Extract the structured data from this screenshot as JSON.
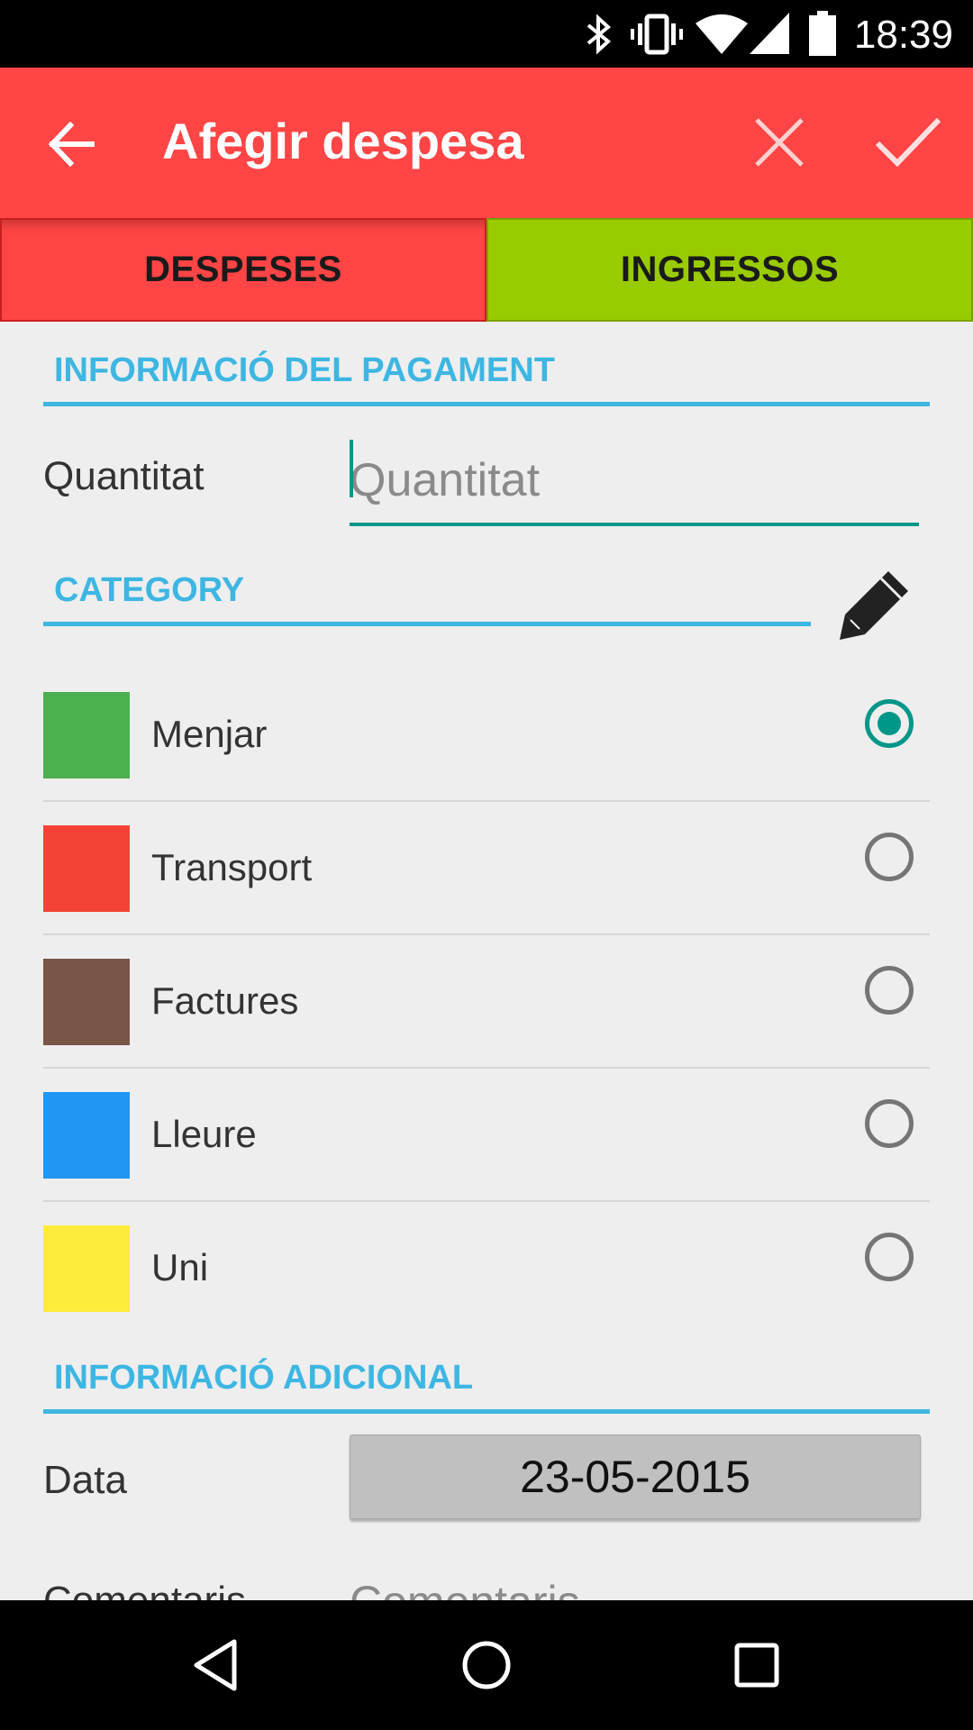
{
  "status_bar": {
    "time": "18:39",
    "icons": [
      "bluetooth-icon",
      "vibrate-icon",
      "wifi-icon",
      "signal-icon",
      "battery-icon"
    ]
  },
  "app_bar": {
    "title": "Afegir despesa",
    "back_icon": "arrow-back-icon",
    "close_icon": "close-icon",
    "confirm_icon": "check-icon",
    "color": "#ff4545"
  },
  "tabs": [
    {
      "label": "DESPESES",
      "color": "#ff4545",
      "selected": true
    },
    {
      "label": "INGRESSOS",
      "color": "#99cc00",
      "selected": false
    }
  ],
  "payment_section": {
    "header": "INFORMACIÓ DEL PAGAMENT",
    "quantity_label": "Quantitat",
    "quantity_placeholder": "Quantitat",
    "quantity_value": ""
  },
  "category_section": {
    "header": "CATEGORY",
    "edit_icon": "pencil-icon",
    "items": [
      {
        "label": "Menjar",
        "color": "#4caf50",
        "selected": true
      },
      {
        "label": "Transport",
        "color": "#f44336",
        "selected": false
      },
      {
        "label": "Factures",
        "color": "#795548",
        "selected": false
      },
      {
        "label": "Lleure",
        "color": "#2196f3",
        "selected": false
      },
      {
        "label": "Uni",
        "color": "#ffeb3b",
        "selected": false
      }
    ]
  },
  "additional_section": {
    "header": "INFORMACIÓ ADICIONAL",
    "date_label": "Data",
    "date_value": "23-05-2015",
    "comment_label": "Comentaris",
    "comment_placeholder": "Comentaris"
  },
  "nav_bar": {
    "icons": [
      "back-triangle-icon",
      "home-circle-icon",
      "recents-square-icon"
    ]
  },
  "accent_colors": {
    "section": "#3db6e2",
    "teal": "#009688"
  }
}
